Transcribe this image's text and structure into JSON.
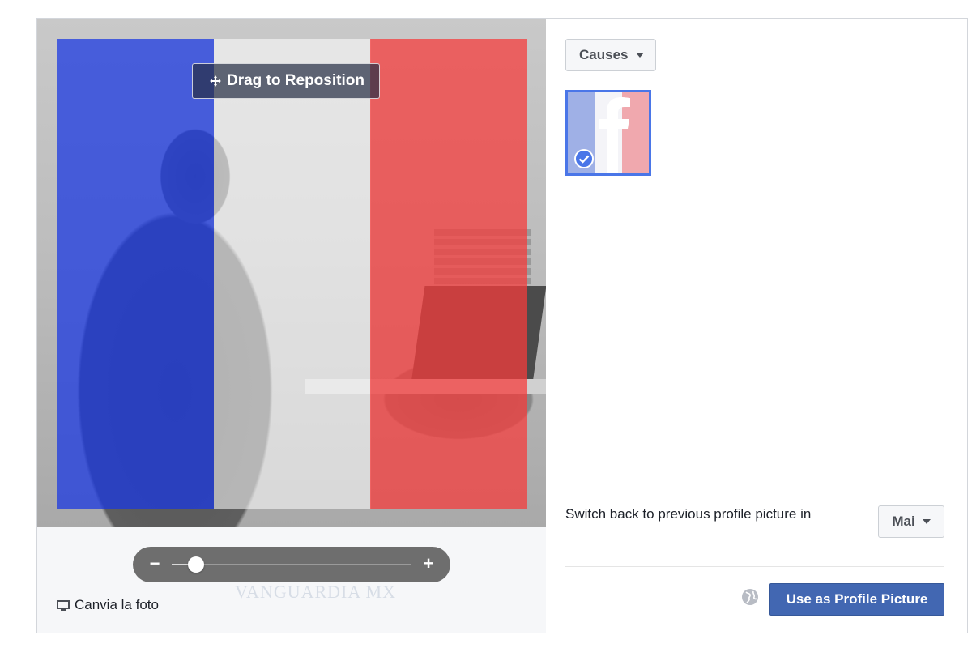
{
  "editor": {
    "drag_label": "Drag to Reposition",
    "zoom": {
      "minus_label": "−",
      "plus_label": "+",
      "level_fraction": 0.1
    },
    "change_photo_label": "Canvia la foto",
    "flag_colors": {
      "blue": "#1937e1",
      "white": "#ffffff",
      "red": "#f53c3c"
    }
  },
  "panel": {
    "causes_label": "Causes",
    "selected_frame": {
      "name": "France flag frame",
      "selected": true
    },
    "switch_back_label": "Switch back to previous profile picture in",
    "duration_value": "Mai",
    "use_button_label": "Use as Profile Picture",
    "accent_color": "#4267b2"
  },
  "watermark": "VANGUARDIA MX"
}
